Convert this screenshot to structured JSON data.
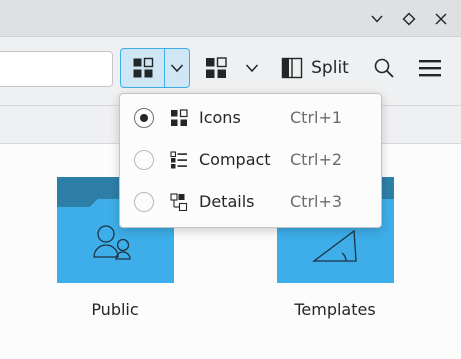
{
  "titlebar": {
    "buttons": [
      {
        "name": "minimize",
        "icon": "chevron-down-icon"
      },
      {
        "name": "maximize",
        "icon": "diamond-icon"
      },
      {
        "name": "close",
        "icon": "close-icon"
      }
    ]
  },
  "toolbar": {
    "view_mode_icon": "icons-view-icon",
    "split_label": "Split",
    "search_icon": "search-icon",
    "menu_icon": "hamburger-menu-icon"
  },
  "view_menu": {
    "items": [
      {
        "label": "Icons",
        "shortcut": "Ctrl+1",
        "checked": true,
        "icon": "icons-view-icon"
      },
      {
        "label": "Compact",
        "shortcut": "Ctrl+2",
        "checked": false,
        "icon": "compact-view-icon"
      },
      {
        "label": "Details",
        "shortcut": "Ctrl+3",
        "checked": false,
        "icon": "details-view-icon"
      }
    ]
  },
  "files": [
    {
      "name": "Public",
      "icon": "folder-public-icon"
    },
    {
      "name": "Templates",
      "icon": "folder-templates-icon"
    }
  ],
  "colors": {
    "accent": "#3daee9",
    "accent_fill": "#cfe6f5",
    "folder_body": "#3daee9",
    "folder_tab": "#2d7fa8"
  }
}
